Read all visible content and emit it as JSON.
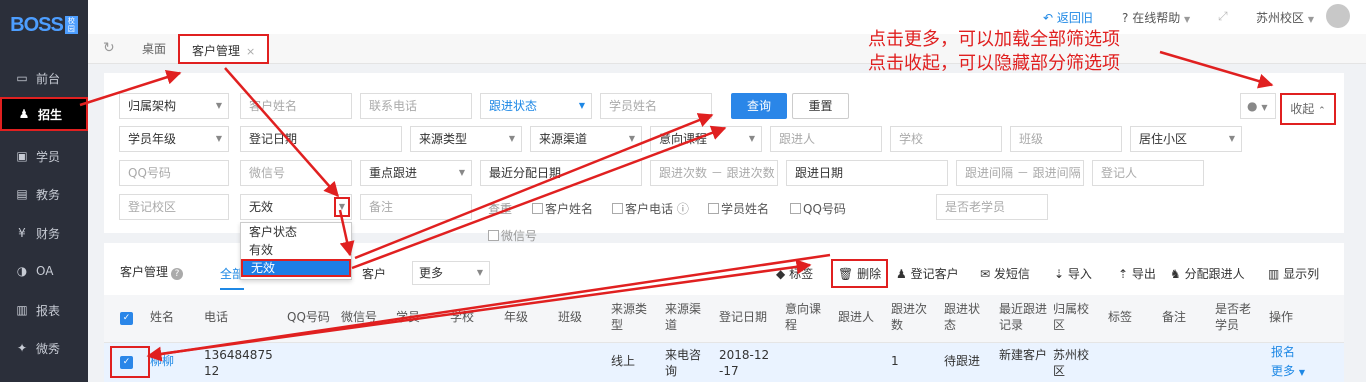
{
  "app": {
    "logo_text": "BOSS",
    "logo_sub": "校园"
  },
  "sidebar": {
    "items": [
      {
        "label": "前台",
        "icon": "monitor-icon"
      },
      {
        "label": "招生",
        "icon": "user-plus-icon",
        "active": true
      },
      {
        "label": "学员",
        "icon": "id-card-icon"
      },
      {
        "label": "教务",
        "icon": "book-icon"
      },
      {
        "label": "财务",
        "icon": "yen-icon"
      },
      {
        "label": "OA",
        "icon": "toggle-icon"
      },
      {
        "label": "报表",
        "icon": "bar-chart-icon"
      },
      {
        "label": "微秀",
        "icon": "flame-icon"
      }
    ]
  },
  "topbar": {
    "return_label": "返回旧",
    "help_label": "在线帮助",
    "school_label": "苏州校区"
  },
  "tabs": {
    "home_label": "桌面",
    "crm_label": "客户管理",
    "close_glyph": "×"
  },
  "filters": {
    "row1": {
      "owner_org": "归属架构",
      "customer_name_ph": "客户姓名",
      "phone_ph": "联系电话",
      "follow_status": "跟进状态",
      "student_name_ph": "学员姓名"
    },
    "query_label": "查询",
    "reset_label": "重置",
    "collapse_label": "收起",
    "row2": {
      "grade": "学员年级",
      "reg_date_ph": "登记日期",
      "source_type": "来源类型",
      "source_channel": "来源渠道",
      "intent_course": "意向课程",
      "follower_ph": "跟进人",
      "school_ph": "学校",
      "class_ph": "班级",
      "community": "居住小区"
    },
    "row3": {
      "qq_ph": "QQ号码",
      "wechat_ph": "微信号",
      "key_follow": "重点跟进",
      "last_assign_ph": "最近分配日期",
      "follow_count_ph": "跟进次数 － 跟进次数",
      "follow_date_ph": "跟进日期",
      "follow_interval_ph": "跟进间隔 － 跟进间隔",
      "registrar_ph": "登记人"
    },
    "row4": {
      "reg_campus_ph": "登记校区",
      "validity": "无效",
      "remark_ph": "备注",
      "search_in_label": "查重",
      "chk_customer_name": "客户姓名",
      "chk_customer_phone": "客户电话",
      "chk_student_name": "学员姓名",
      "chk_qq": "QQ号码",
      "old_student_ph": "是否老学员",
      "chk_wechat": "微信号"
    },
    "validity_options": [
      "客户状态",
      "有效",
      "无效"
    ]
  },
  "list": {
    "title": "客户管理",
    "tab_all": "全部",
    "tab_customer": "客户",
    "more_label": "更多",
    "toolbar": {
      "tag": "标签",
      "delete": "删除",
      "register": "登记客户",
      "sms": "发短信",
      "import": "导入",
      "export": "导出",
      "assign": "分配跟进人",
      "columns": "显示列"
    },
    "headers": [
      "姓名",
      "电话",
      "QQ号码",
      "微信号",
      "学员",
      "学校",
      "年级",
      "班级",
      "来源类型",
      "来源渠道",
      "登记日期",
      "意向课程",
      "跟进人",
      "跟进次数",
      "跟进状态",
      "最近跟进记录",
      "归属校区",
      "标签",
      "备注",
      "是否老学员",
      "操作"
    ],
    "rows": [
      {
        "name": "柳柳",
        "phone": "13648487512",
        "source_type": "线上",
        "source_channel": "来电咨询",
        "reg_date": "2018-12-17",
        "follow_count": "1",
        "follow_status": "待跟进",
        "last_record": "新建客户",
        "campus": "苏州校区",
        "action_enroll": "报名",
        "action_more": "更多"
      }
    ]
  },
  "annotation": {
    "line1": "点击更多，可以加载全部筛选项",
    "line2": "点击收起，可以隐藏部分筛选项"
  },
  "colors": {
    "accent": "#2a86e8",
    "sidebar_bg": "#2b2f3a",
    "annotation": "#e02020"
  }
}
